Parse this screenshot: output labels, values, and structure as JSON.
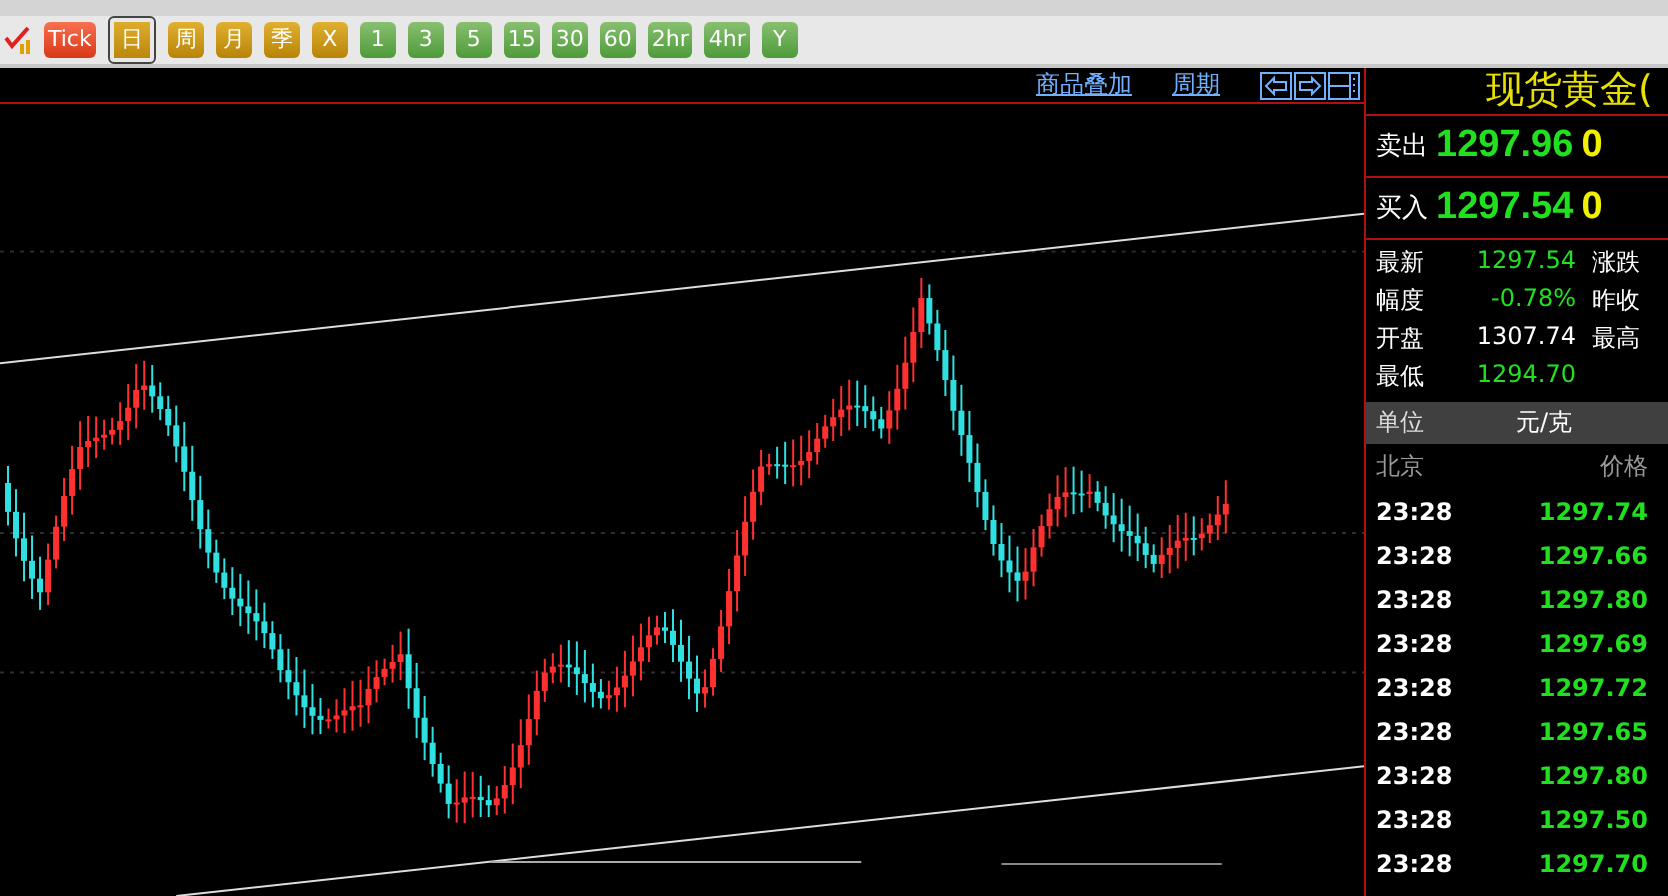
{
  "toolbar": {
    "buttons": [
      {
        "label": "Tick",
        "kind": "tick",
        "selected": false
      },
      {
        "label": "日",
        "kind": "period",
        "selected": true
      },
      {
        "label": "周",
        "kind": "period",
        "selected": false
      },
      {
        "label": "月",
        "kind": "period",
        "selected": false
      },
      {
        "label": "季",
        "kind": "period",
        "selected": false
      },
      {
        "label": "X",
        "kind": "period",
        "selected": false
      },
      {
        "label": "1",
        "kind": "minute",
        "selected": false
      },
      {
        "label": "3",
        "kind": "minute",
        "selected": false
      },
      {
        "label": "5",
        "kind": "minute",
        "selected": false
      },
      {
        "label": "15",
        "kind": "minute",
        "selected": false
      },
      {
        "label": "30",
        "kind": "minute",
        "selected": false
      },
      {
        "label": "60",
        "kind": "minute",
        "selected": false
      },
      {
        "label": "2hr",
        "kind": "minute",
        "selected": false
      },
      {
        "label": "4hr",
        "kind": "minute",
        "selected": false
      },
      {
        "label": "Y",
        "kind": "minute",
        "selected": false
      }
    ]
  },
  "chart": {
    "links": [
      "商品叠加",
      "周期"
    ]
  },
  "quote": {
    "title": "现货黄金(",
    "sell": {
      "label": "卖出",
      "price": "1297.96",
      "volume": "0"
    },
    "buy": {
      "label": "买入",
      "price": "1297.54",
      "volume": "0"
    },
    "stats": [
      {
        "label": "最新",
        "value": "1297.54",
        "kind": "up",
        "extra": "涨跌"
      },
      {
        "label": "幅度",
        "value": "-0.78%",
        "kind": "up",
        "extra": "昨收"
      },
      {
        "label": "开盘",
        "value": "1307.74",
        "kind": "flat",
        "extra": "最高"
      },
      {
        "label": "最低",
        "value": "1294.70",
        "kind": "up"
      }
    ],
    "unit": {
      "label": "单位",
      "value": "元/克"
    },
    "ticks_header": [
      "北京",
      "价格"
    ],
    "ticks": [
      {
        "time": "23:28",
        "price": "1297.74"
      },
      {
        "time": "23:28",
        "price": "1297.66"
      },
      {
        "time": "23:28",
        "price": "1297.80"
      },
      {
        "time": "23:28",
        "price": "1297.69"
      },
      {
        "time": "23:28",
        "price": "1297.72"
      },
      {
        "time": "23:28",
        "price": "1297.65"
      },
      {
        "time": "23:28",
        "price": "1297.80"
      },
      {
        "time": "23:28",
        "price": "1297.50"
      },
      {
        "time": "23:28",
        "price": "1297.70"
      }
    ]
  }
}
